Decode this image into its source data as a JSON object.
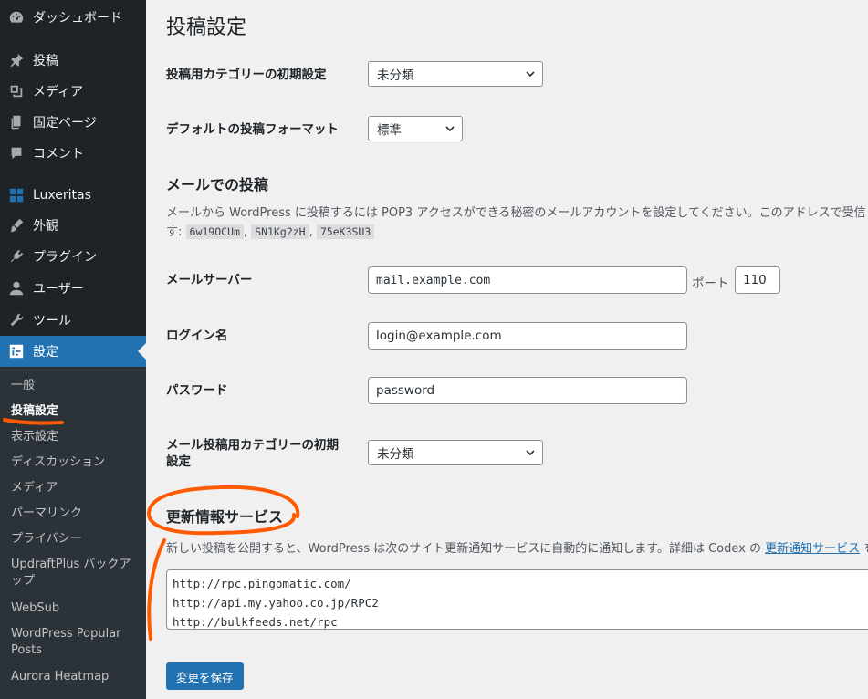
{
  "sidebar": {
    "items": [
      {
        "label": "ダッシュボード",
        "icon": "dashboard-icon"
      },
      {
        "label": "投稿",
        "icon": "pushpin-icon"
      },
      {
        "label": "メディア",
        "icon": "media-icon"
      },
      {
        "label": "固定ページ",
        "icon": "page-icon"
      },
      {
        "label": "コメント",
        "icon": "comment-icon"
      },
      {
        "label": "Luxeritas",
        "icon": "grid-icon"
      },
      {
        "label": "外観",
        "icon": "brush-icon"
      },
      {
        "label": "プラグイン",
        "icon": "plug-icon"
      },
      {
        "label": "ユーザー",
        "icon": "user-icon"
      },
      {
        "label": "ツール",
        "icon": "wrench-icon"
      },
      {
        "label": "設定",
        "icon": "settings-icon"
      }
    ],
    "submenu": [
      "一般",
      "投稿設定",
      "表示設定",
      "ディスカッション",
      "メディア",
      "パーマリンク",
      "プライバシー",
      "UpdraftPlus バックアップ",
      "WebSub",
      "WordPress Popular Posts",
      "Aurora Heatmap"
    ]
  },
  "main": {
    "title": "投稿設定",
    "default_category": {
      "label": "投稿用カテゴリーの初期設定",
      "value": "未分類"
    },
    "default_format": {
      "label": "デフォルトの投稿フォーマット",
      "value": "標準"
    },
    "post_via_email": {
      "title": "メールでの投稿",
      "desc_line1": "メールから WordPress に投稿するには POP3 アクセスができる秘密のメールアカウントを設定してください。このアドレスで受信し",
      "desc_line2_prefix": "す:",
      "codes": [
        "6w19OCUm",
        "SN1Kg2zH",
        "75eK3SU3"
      ],
      "separator": ","
    },
    "mail_server": {
      "label": "メールサーバー",
      "value": "mail.example.com",
      "port_label": "ポート",
      "port_value": "110"
    },
    "login_name": {
      "label": "ログイン名",
      "value": "login@example.com"
    },
    "password": {
      "label": "パスワード",
      "value": "password"
    },
    "mail_category": {
      "label_line1": "メール投稿用カテゴリーの初期",
      "label_line2": "設定",
      "value": "未分類"
    },
    "update_services": {
      "title": "更新情報サービス",
      "desc_prefix": "新しい投稿を公開すると、WordPress は次のサイト更新通知サービスに自動的に通知します。詳細は Codex の",
      "desc_link": "更新通知サービス",
      "desc_suffix": "を参",
      "urls": [
        "http://rpc.pingomatic.com/",
        "http://api.my.yahoo.co.jp/RPC2",
        "http://bulkfeeds.net/rpc"
      ]
    },
    "save_label": "変更を保存"
  },
  "colors": {
    "sidebar_bg": "#1d2327",
    "submenu_bg": "#2c3338",
    "accent": "#2271b1",
    "annotation": "#ff5a00",
    "content_bg": "#f0f0f1"
  }
}
